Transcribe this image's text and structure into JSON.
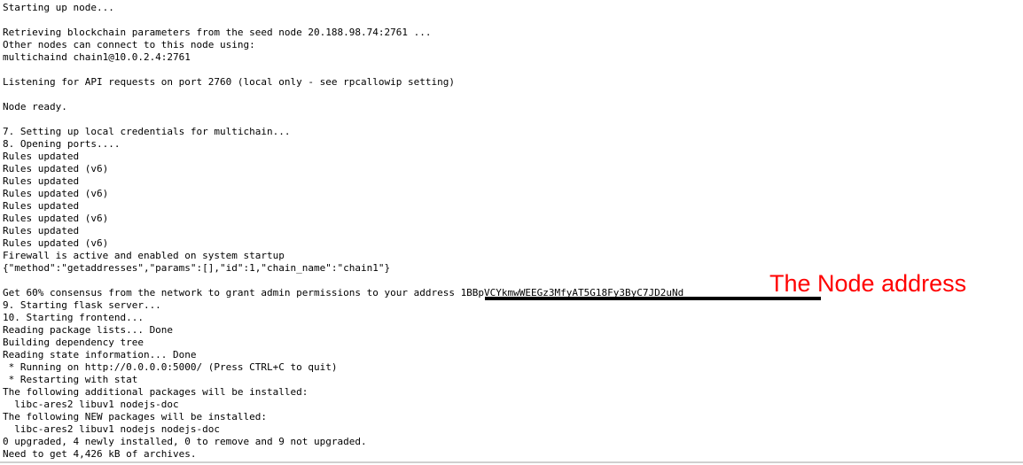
{
  "terminal": {
    "lines": [
      "Starting up node...",
      "",
      "Retrieving blockchain parameters from the seed node 20.188.98.74:2761 ...",
      "Other nodes can connect to this node using:",
      "multichaind chain1@10.0.2.4:2761",
      "",
      "Listening for API requests on port 2760 (local only - see rpcallowip setting)",
      "",
      "Node ready.",
      "",
      "7. Setting up local credentials for multichain...",
      "8. Opening ports....",
      "Rules updated",
      "Rules updated (v6)",
      "Rules updated",
      "Rules updated (v6)",
      "Rules updated",
      "Rules updated (v6)",
      "Rules updated",
      "Rules updated (v6)",
      "Firewall is active and enabled on system startup",
      "{\"method\":\"getaddresses\",\"params\":[],\"id\":1,\"chain_name\":\"chain1\"}",
      "",
      null,
      "9. Starting flask server...",
      "10. Starting frontend...",
      "Reading package lists... Done",
      "Building dependency tree",
      "Reading state information... Done",
      " * Running on http://0.0.0.0:5000/ (Press CTRL+C to quit)",
      " * Restarting with stat",
      "The following additional packages will be installed:",
      "  libc-ares2 libuv1 nodejs-doc",
      "The following NEW packages will be installed:",
      "  libc-ares2 libuv1 nodejs nodejs-doc",
      "0 upgraded, 4 newly installed, 0 to remove and 9 not upgraded.",
      "Need to get 4,426 kB of archives."
    ],
    "consensus_prefix": "Get 60% consensus from the network to grant admin permissions to your address ",
    "node_address": "1BBpVCYkmwWEEGz3MfyAT5G18Fy3ByC7JD2uNd"
  },
  "annotation": {
    "label": "The Node address",
    "color": "#ff0000",
    "underline_color": "#000000"
  }
}
